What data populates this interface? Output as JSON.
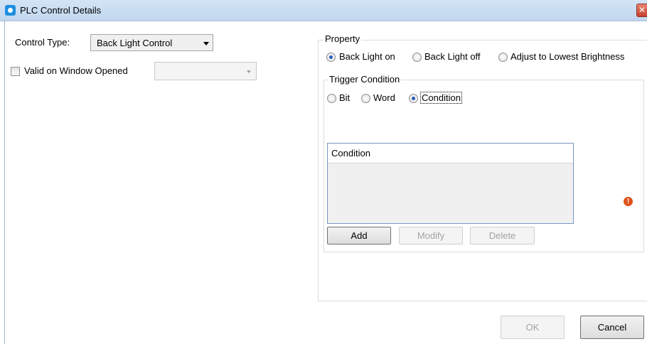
{
  "window": {
    "title": "PLC Control Details",
    "close_glyph": "✕"
  },
  "left": {
    "control_type_label": "Control Type:",
    "control_type_value": "Back Light Control",
    "valid_label": "Valid on Window Opened",
    "valid_checked": false,
    "valid_dropdown_value": ""
  },
  "property": {
    "legend": "Property",
    "options": [
      {
        "label": "Back Light on",
        "checked": true
      },
      {
        "label": "Back Light off",
        "checked": false
      },
      {
        "label": "Adjust to Lowest Brightness",
        "checked": false
      }
    ]
  },
  "trigger": {
    "legend": "Trigger Condition",
    "options": [
      {
        "label": "Bit",
        "checked": false
      },
      {
        "label": "Word",
        "checked": false
      },
      {
        "label": "Condition",
        "checked": true
      }
    ],
    "list_header": "Condition",
    "warning_glyph": "!",
    "buttons": {
      "add": "Add",
      "modify": "Modify",
      "delete": "Delete"
    }
  },
  "footer": {
    "ok": "OK",
    "cancel": "Cancel"
  }
}
